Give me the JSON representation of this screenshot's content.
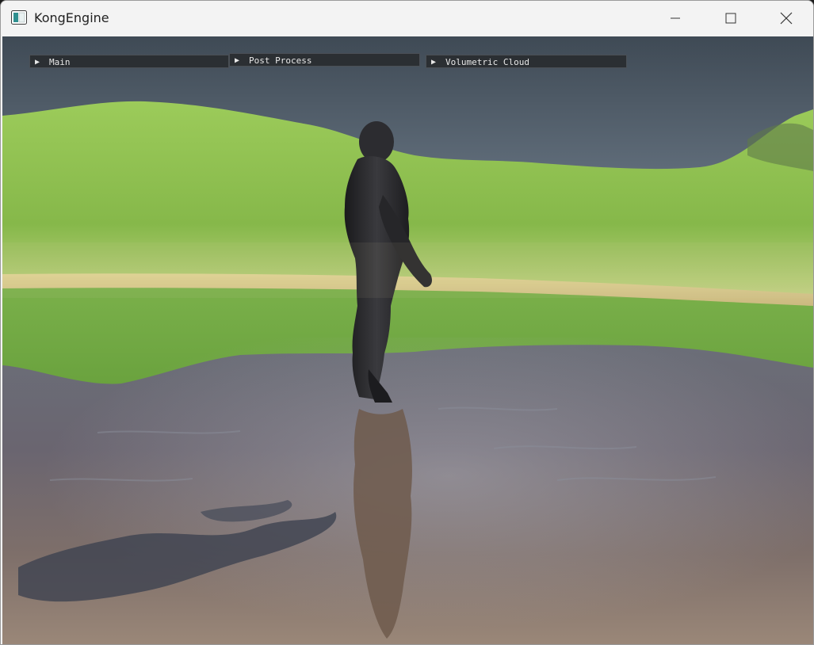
{
  "window": {
    "title": "KongEngine",
    "controls": {
      "minimize": "minimize",
      "maximize": "maximize",
      "close": "close"
    }
  },
  "panels": [
    {
      "label": "Main",
      "arrow": "▶"
    },
    {
      "label": "Post Process",
      "arrow": "▶"
    },
    {
      "label": "Volumetric Cloud",
      "arrow": "▶"
    }
  ],
  "scene": {
    "sky_color": "#5d6a78",
    "terrain_color": "#8fbf4c",
    "water_color": "#6b6670",
    "sand_color": "#d9c98f"
  }
}
